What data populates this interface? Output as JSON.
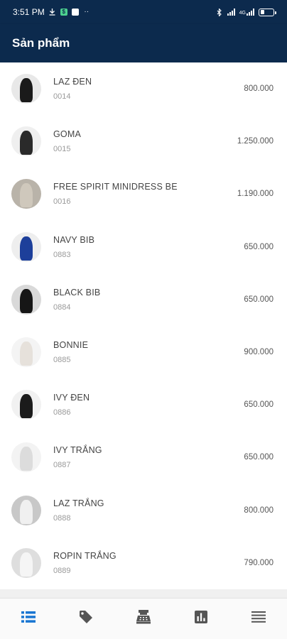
{
  "status_bar": {
    "time": "3:51 PM",
    "icons": [
      "download-icon",
      "app-notification-icon",
      "shopping-bag-icon",
      "more-dots-icon",
      "bluetooth-icon",
      "signal-icon",
      "4g-signal-icon",
      "battery-icon"
    ],
    "network_label": "4G"
  },
  "app_bar": {
    "title": "Sản phẩm"
  },
  "products": [
    {
      "name": "LAZ ĐEN",
      "code": "0014",
      "price": "800.000",
      "avatar_bg": "#e8e8e8",
      "avatar_fig": "#1a1a1a"
    },
    {
      "name": "GOMA",
      "code": "0015",
      "price": "1.250.000",
      "avatar_bg": "#efefef",
      "avatar_fig": "#2a2a2a"
    },
    {
      "name": "FREE SPIRIT MINIDRESS BE",
      "code": "0016",
      "price": "1.190.000",
      "avatar_bg": "#b9b3a9",
      "avatar_fig": "#cfc8bc"
    },
    {
      "name": "NAVY BIB",
      "code": "0883",
      "price": "650.000",
      "avatar_bg": "#eeeeee",
      "avatar_fig": "#1d3f9a"
    },
    {
      "name": "BLACK BIB",
      "code": "0884",
      "price": "650.000",
      "avatar_bg": "#d9d9d9",
      "avatar_fig": "#161616"
    },
    {
      "name": "BONNIE",
      "code": "0885",
      "price": "900.000",
      "avatar_bg": "#f4f4f4",
      "avatar_fig": "#e6e1db"
    },
    {
      "name": "IVY ĐEN",
      "code": "0886",
      "price": "650.000",
      "avatar_bg": "#f1f1f1",
      "avatar_fig": "#1b1b1b"
    },
    {
      "name": "IVY TRẮNG",
      "code": "0887",
      "price": "650.000",
      "avatar_bg": "#f3f3f3",
      "avatar_fig": "#dcdcdc"
    },
    {
      "name": "LAZ TRẮNG",
      "code": "0888",
      "price": "800.000",
      "avatar_bg": "#c8c8c8",
      "avatar_fig": "#f0f0f0"
    },
    {
      "name": "ROPIN TRẮNG",
      "code": "0889",
      "price": "790.000",
      "avatar_bg": "#dedede",
      "avatar_fig": "#f5f5f5"
    }
  ],
  "bottom_nav": {
    "items": [
      "list-icon",
      "tag-icon",
      "cash-register-icon",
      "bar-chart-icon",
      "menu-icon"
    ],
    "active_index": 0,
    "active_color": "#1976d2",
    "inactive_color": "#555555"
  },
  "colors": {
    "header": "#0c2a4d"
  }
}
